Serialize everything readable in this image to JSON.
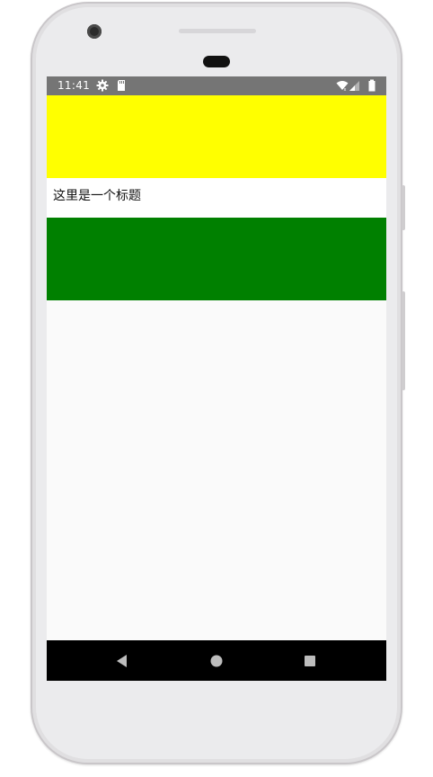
{
  "status_bar": {
    "time": "11:41",
    "icons": [
      "gear-icon",
      "sd-card-icon",
      "wifi-icon",
      "signal-icon",
      "battery-icon"
    ]
  },
  "content": {
    "title": "这里是一个标题",
    "colors": {
      "top_block": "#ffff00",
      "bottom_block": "#008000"
    }
  },
  "nav_bar": {
    "buttons": [
      "back-icon",
      "home-icon",
      "recents-icon"
    ]
  }
}
